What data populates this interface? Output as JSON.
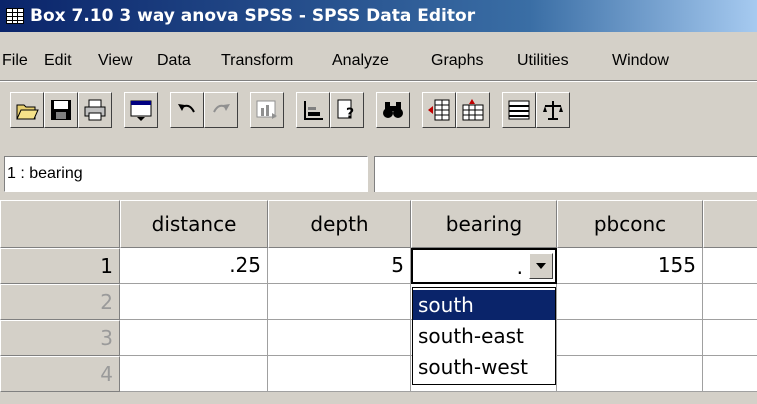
{
  "window": {
    "title": "Box 7.10 3 way anova SPSS - SPSS Data Editor",
    "app_icon": "grid-icon"
  },
  "menubar": {
    "items": [
      "File",
      "Edit",
      "View",
      "Data",
      "Transform",
      "Analyze",
      "Graphs",
      "Utilities",
      "Window"
    ]
  },
  "toolbar": {
    "buttons": [
      "open-icon",
      "save-icon",
      "print-icon",
      "dialog-recall-icon",
      "undo-icon",
      "redo-icon",
      "goto-chart-icon",
      "goto-case-icon",
      "variables-icon",
      "find-icon",
      "insert-case-icon",
      "insert-variable-icon",
      "split-file-icon",
      "weight-cases-icon"
    ]
  },
  "cell_editor": {
    "label": "1 : bearing",
    "value": ""
  },
  "grid": {
    "columns": [
      "distance",
      "depth",
      "bearing",
      "pbconc"
    ],
    "rows": [
      {
        "num": "1",
        "distance": ".25",
        "depth": "5",
        "bearing": ".",
        "pbconc": "155"
      },
      {
        "num": "2",
        "distance": "",
        "depth": "",
        "bearing": "",
        "pbconc": ""
      },
      {
        "num": "3",
        "distance": "",
        "depth": "",
        "bearing": "",
        "pbconc": ""
      },
      {
        "num": "4",
        "distance": "",
        "depth": "",
        "bearing": "",
        "pbconc": ""
      }
    ]
  },
  "dropdown": {
    "options": [
      "south",
      "south-east",
      "south-west"
    ],
    "selected": "south"
  },
  "colors": {
    "title_bar": "#0a246a",
    "selection": "#0a246a",
    "face": "#d4d0c8"
  }
}
